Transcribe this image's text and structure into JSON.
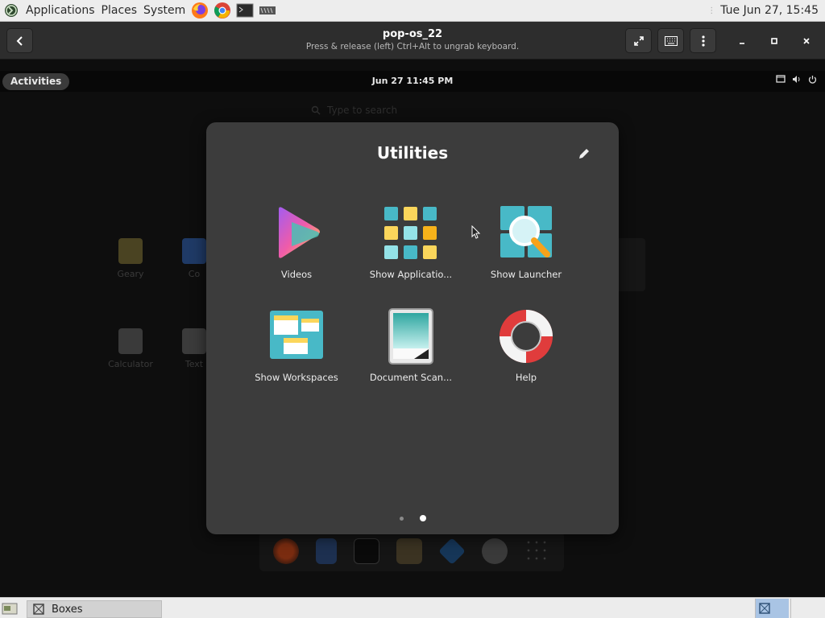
{
  "host_topbar": {
    "menu_applications": "Applications",
    "menu_places": "Places",
    "menu_system": "System",
    "clock": "Tue Jun 27, 15:45"
  },
  "header": {
    "title": "pop-os_22",
    "subtitle": "Press & release (left) Ctrl+Alt to ungrab keyboard."
  },
  "guest": {
    "activities": "Activities",
    "clock": "Jun 27  11:45 PM",
    "search_placeholder": "Type to search",
    "background_apps": [
      {
        "label": "Geary"
      },
      {
        "label": "Co"
      },
      {
        "label": "Calculator"
      },
      {
        "label": "Text"
      }
    ]
  },
  "folder": {
    "title": "Utilities",
    "apps": [
      {
        "label": "Videos",
        "icon": "videos-icon"
      },
      {
        "label": "Show Applicatio...",
        "icon": "show-applications-icon"
      },
      {
        "label": "Show Launcher",
        "icon": "show-launcher-icon"
      },
      {
        "label": "Show Workspaces",
        "icon": "show-workspaces-icon"
      },
      {
        "label": "Document Scan...",
        "icon": "document-scanner-icon"
      },
      {
        "label": "Help",
        "icon": "help-icon"
      }
    ],
    "pages": 2,
    "current_page": 2
  },
  "taskbar": {
    "window_label": "Boxes"
  },
  "colors": {
    "folder_bg": "#3c3c3c",
    "accent_teal": "#48b9c7",
    "accent_yellow": "#fbd65b",
    "help_red": "#e03c3c"
  }
}
